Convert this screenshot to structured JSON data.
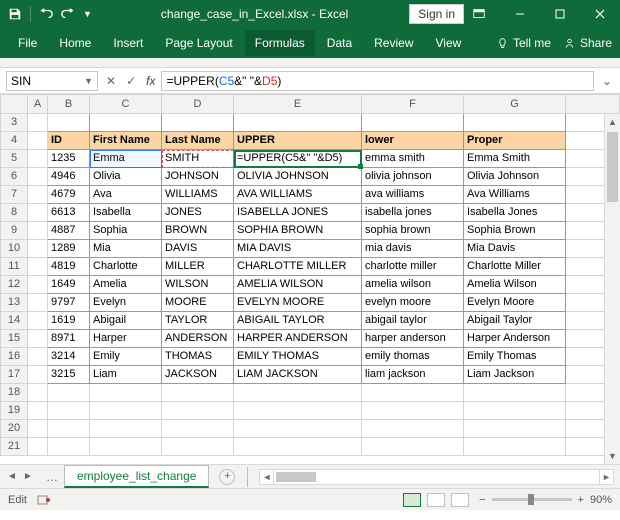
{
  "titlebar": {
    "filename": "change_case_in_Excel.xlsx",
    "appname": "Excel",
    "signin": "Sign in"
  },
  "ribbon": {
    "tabs": [
      "File",
      "Home",
      "Insert",
      "Page Layout",
      "Formulas",
      "Data",
      "Review",
      "View"
    ],
    "active": 4,
    "tellme": "Tell me",
    "share": "Share"
  },
  "formula_bar": {
    "namebox": "SIN",
    "fx": "fx",
    "formula_prefix": "=UPPER(",
    "formula_ref1": "C5",
    "formula_mid": "&\" \"&",
    "formula_ref2": "D5",
    "formula_suffix": ")"
  },
  "columns": [
    "A",
    "B",
    "C",
    "D",
    "E",
    "F",
    "G"
  ],
  "row_start": 3,
  "row_end": 21,
  "headers_row": 4,
  "headers": {
    "B": "ID",
    "C": "First Name",
    "D": "Last Name",
    "E": "UPPER",
    "F": "lower",
    "G": "Proper"
  },
  "data_rows": [
    {
      "r": 5,
      "B": "1235",
      "C": "Emma",
      "D": "SMITH",
      "E": "=UPPER(C5&\" \"&D5)",
      "F": "emma smith",
      "G": "Emma Smith"
    },
    {
      "r": 6,
      "B": "4946",
      "C": "Olivia",
      "D": "JOHNSON",
      "E": "OLIVIA JOHNSON",
      "F": "olivia johnson",
      "G": "Olivia Johnson"
    },
    {
      "r": 7,
      "B": "4679",
      "C": "Ava",
      "D": "WILLIAMS",
      "E": "AVA WILLIAMS",
      "F": "ava williams",
      "G": "Ava Williams"
    },
    {
      "r": 8,
      "B": "6613",
      "C": "Isabella",
      "D": "JONES",
      "E": "ISABELLA JONES",
      "F": "isabella jones",
      "G": "Isabella Jones"
    },
    {
      "r": 9,
      "B": "4887",
      "C": "Sophia",
      "D": "BROWN",
      "E": "SOPHIA BROWN",
      "F": "sophia brown",
      "G": "Sophia Brown"
    },
    {
      "r": 10,
      "B": "1289",
      "C": "Mia",
      "D": "DAVIS",
      "E": "MIA DAVIS",
      "F": "mia davis",
      "G": "Mia Davis"
    },
    {
      "r": 11,
      "B": "4819",
      "C": "Charlotte",
      "D": "MILLER",
      "E": "CHARLOTTE MILLER",
      "F": "charlotte miller",
      "G": "Charlotte Miller"
    },
    {
      "r": 12,
      "B": "1649",
      "C": "Amelia",
      "D": "WILSON",
      "E": "AMELIA WILSON",
      "F": "amelia wilson",
      "G": "Amelia Wilson"
    },
    {
      "r": 13,
      "B": "9797",
      "C": "Evelyn",
      "D": "MOORE",
      "E": "EVELYN MOORE",
      "F": "evelyn moore",
      "G": "Evelyn Moore"
    },
    {
      "r": 14,
      "B": "1619",
      "C": "Abigail",
      "D": "TAYLOR",
      "E": "ABIGAIL TAYLOR",
      "F": "abigail taylor",
      "G": "Abigail Taylor"
    },
    {
      "r": 15,
      "B": "8971",
      "C": "Harper",
      "D": "ANDERSON",
      "E": "HARPER ANDERSON",
      "F": "harper anderson",
      "G": "Harper Anderson"
    },
    {
      "r": 16,
      "B": "3214",
      "C": "Emily",
      "D": "THOMAS",
      "E": "EMILY THOMAS",
      "F": "emily thomas",
      "G": "Emily Thomas"
    },
    {
      "r": 17,
      "B": "3215",
      "C": "Liam",
      "D": "JACKSON",
      "E": "LIAM JACKSON",
      "F": "liam jackson",
      "G": "Liam Jackson"
    }
  ],
  "sheet_tabs": {
    "active": "employee_list_change"
  },
  "statusbar": {
    "mode": "Edit",
    "zoom": "90%"
  }
}
